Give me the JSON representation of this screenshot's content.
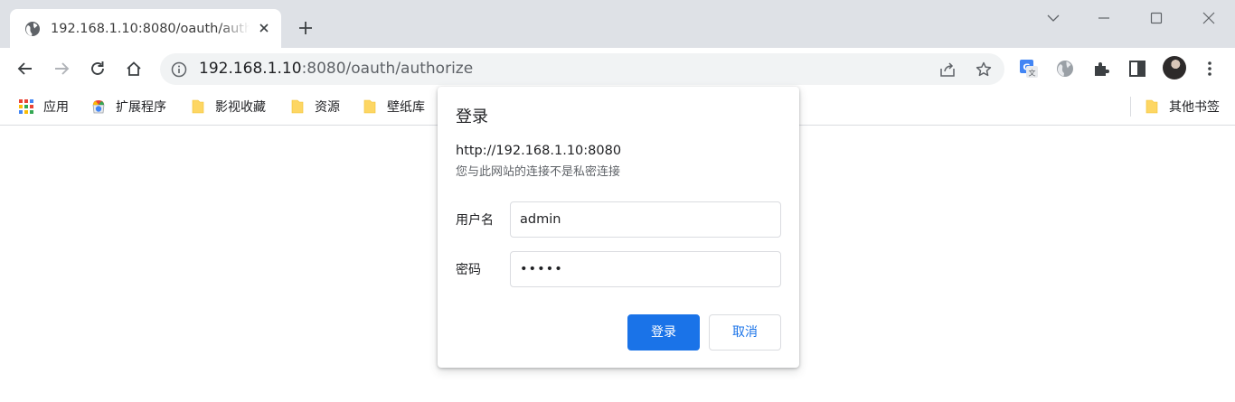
{
  "colors": {
    "accent": "#1a73e8",
    "tabstrip_bg": "#dee1e6",
    "omnibox_bg": "#f1f3f4"
  },
  "tab": {
    "title": "192.168.1.10:8080/oauth/authorize",
    "icon": "globe-icon"
  },
  "omnibox": {
    "url_host": "192.168.1.10",
    "url_rest": ":8080/oauth/authorize"
  },
  "bookmarks": [
    {
      "label": "应用",
      "icon": "apps-grid-icon"
    },
    {
      "label": "扩展程序",
      "icon": "chrome-web-store-icon"
    },
    {
      "label": "影视收藏",
      "icon": "folder-icon"
    },
    {
      "label": "资源",
      "icon": "folder-icon"
    },
    {
      "label": "壁纸库",
      "icon": "folder-icon"
    }
  ],
  "other_bookmarks": {
    "label": "其他书签",
    "icon": "folder-icon"
  },
  "dialog": {
    "title": "登录",
    "origin": "http://192.168.1.10:8080",
    "warning": "您与此网站的连接不是私密连接",
    "username_label": "用户名",
    "username_value": "admin",
    "password_label": "密码",
    "password_value": "•••••",
    "login_button": "登录",
    "cancel_button": "取消"
  }
}
